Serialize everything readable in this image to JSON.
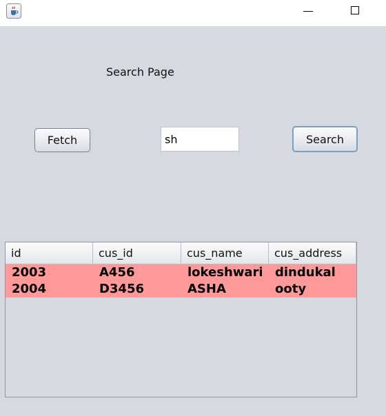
{
  "window": {
    "icons": {
      "app": "java-coffee-cup-icon",
      "minimize": "minimize-icon",
      "maximize": "maximize-icon"
    }
  },
  "form": {
    "title": "Search Page",
    "fetch_label": "Fetch",
    "search_value": "sh",
    "search_label": "Search"
  },
  "table": {
    "headers": [
      "id",
      "cus_id",
      "cus_name",
      "cus_address"
    ],
    "rows": [
      [
        "2003",
        "A456",
        "lokeshwari",
        "dindukal"
      ],
      [
        "2004",
        "D3456",
        "ASHA",
        "ooty"
      ]
    ],
    "row_highlight_color": "#ff9999"
  }
}
